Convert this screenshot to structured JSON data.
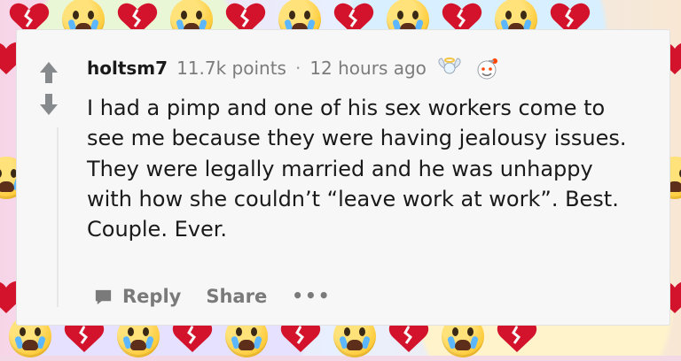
{
  "comment": {
    "username": "holtsm7",
    "points": "11.7k points",
    "separator": "·",
    "time_ago": "12 hours ago",
    "body": "I had a pimp and one of his sex workers come to\nsee me because they were having jealousy issues.\nThey were legally married and he was unhappy\nwith how she couldn’t “leave work at work”. Best.\nCouple. Ever."
  },
  "actions": {
    "reply": "Reply",
    "share": "Share",
    "more": "•••"
  },
  "icons": {
    "upvote": "up-arrow-icon",
    "downvote": "down-arrow-icon",
    "reply": "speech-bubble-icon",
    "award_1": "angel-wings-icon",
    "award_2": "wholesome-icon"
  },
  "colors": {
    "card": "#f7f7f7",
    "text": "#1a1a1b",
    "muted": "#7c7c7c",
    "heart": "#d3122b",
    "emoji_yellow": "#ffcc3d",
    "tear": "#5db7ff"
  }
}
